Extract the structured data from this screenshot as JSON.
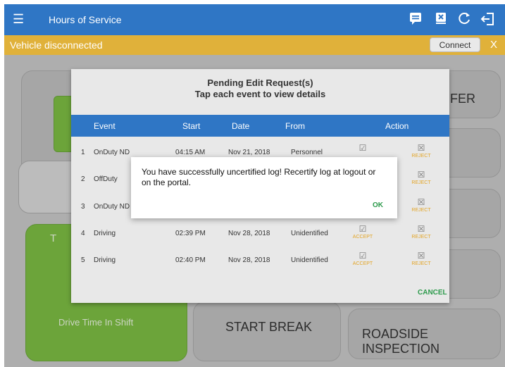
{
  "topbar": {
    "menu_icon": "menu-icon",
    "title": "Hours of Service",
    "icons": [
      "message-icon",
      "uncertify-icon",
      "refresh-icon",
      "logout-icon"
    ]
  },
  "banner": {
    "message": "Vehicle disconnected",
    "connect": "Connect",
    "close": "X"
  },
  "dialog": {
    "title1": "Pending Edit Request(s)",
    "title2": "Tap each event to view details",
    "columns": [
      "Event",
      "Start",
      "Date",
      "From",
      "Action"
    ],
    "rows": [
      {
        "n": "1",
        "event": "OnDuty ND",
        "start": "04:15 AM",
        "date": "Nov 21, 2018",
        "from": "Personnel",
        "accept": "",
        "reject": "REJECT"
      },
      {
        "n": "2",
        "event": "OffDuty",
        "start": "",
        "date": "",
        "from": "",
        "accept": "",
        "reject": "REJECT"
      },
      {
        "n": "3",
        "event": "OnDuty ND",
        "start": "",
        "date": "",
        "from": "",
        "accept": "",
        "reject": "REJECT"
      },
      {
        "n": "4",
        "event": "Driving",
        "start": "02:39 PM",
        "date": "Nov 28, 2018",
        "from": "Unidentified",
        "accept": "ACCEPT",
        "reject": "REJECT"
      },
      {
        "n": "5",
        "event": "Driving",
        "start": "02:40 PM",
        "date": "Nov 28, 2018",
        "from": "Unidentified",
        "accept": "ACCEPT",
        "reject": "REJECT"
      }
    ],
    "cancel": "CANCEL"
  },
  "toast": {
    "message": "You have successfully uncertified log! Recertify log at logout or on the portal.",
    "ok": "OK"
  },
  "background": {
    "fer": "FER",
    "drive_time": "Drive Time In Shift",
    "start_break": "START BREAK",
    "roadside": "ROADSIDE INSPECTION",
    "t_letter": "T"
  }
}
